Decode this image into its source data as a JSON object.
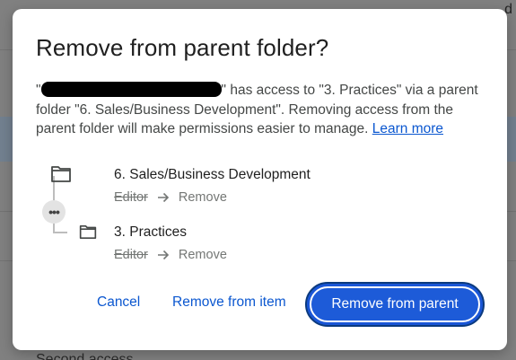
{
  "background": {
    "bottom_text": "Second access",
    "right_glyph": "d"
  },
  "dialog": {
    "title": "Remove from parent folder?",
    "message_prefix": "\"",
    "message_body": "\" has access to \"3. Practices\" via a parent folder \"6. Sales/Business Development\". Removing access from the parent folder will make permissions easier to manage.",
    "learn_more": "Learn more",
    "tree": {
      "parent": {
        "name": "6. Sales/Business Development",
        "old_role": "Editor",
        "new_role": "Remove",
        "icon": "folder-icon"
      },
      "child": {
        "name": "3. Practices",
        "old_role": "Editor",
        "new_role": "Remove",
        "icon": "folder-icon"
      },
      "more_glyph": "•••"
    },
    "actions": {
      "cancel": "Cancel",
      "remove_from_item": "Remove from item",
      "remove_from_parent": "Remove from parent"
    },
    "colors": {
      "primary": "#0b57d0",
      "primary_button": "#1d5bd8"
    }
  }
}
